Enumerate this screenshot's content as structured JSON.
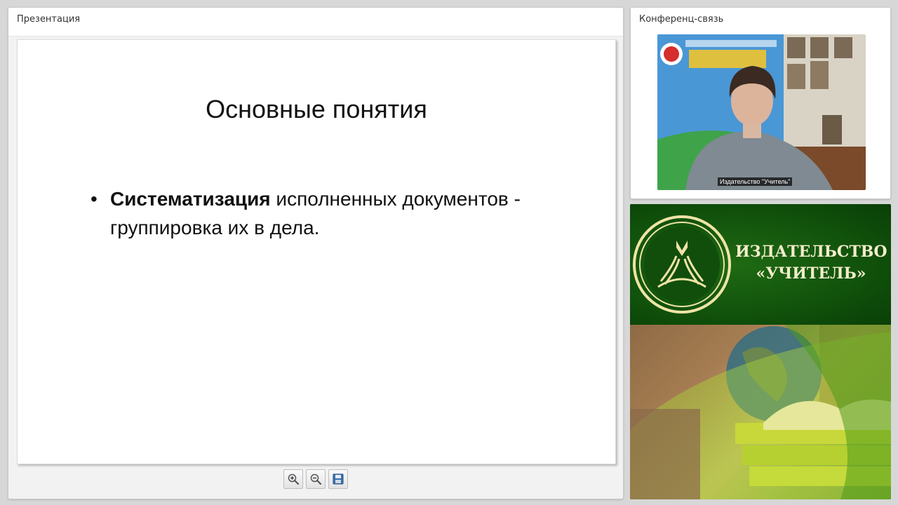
{
  "presentation_panel": {
    "title": "Презентация"
  },
  "slide": {
    "title": "Основные понятия",
    "bullet_marker": "•",
    "bullet_bold": "Систематизация",
    "bullet_rest": " исполненных документов - группировка их в дела."
  },
  "toolbar": {
    "buttons": [
      "zoom-in-icon",
      "zoom-out-icon",
      "save-icon"
    ]
  },
  "conference_panel": {
    "title": "Конференц-связь",
    "video_label": "Издательство \"Учитель\""
  },
  "logo": {
    "line1": "ИЗДАТЕЛЬСТВО",
    "line2": "«УЧИТЕЛЬ»"
  },
  "colors": {
    "logo_green": "#0e4d0a",
    "logo_text": "#f3eccb"
  }
}
